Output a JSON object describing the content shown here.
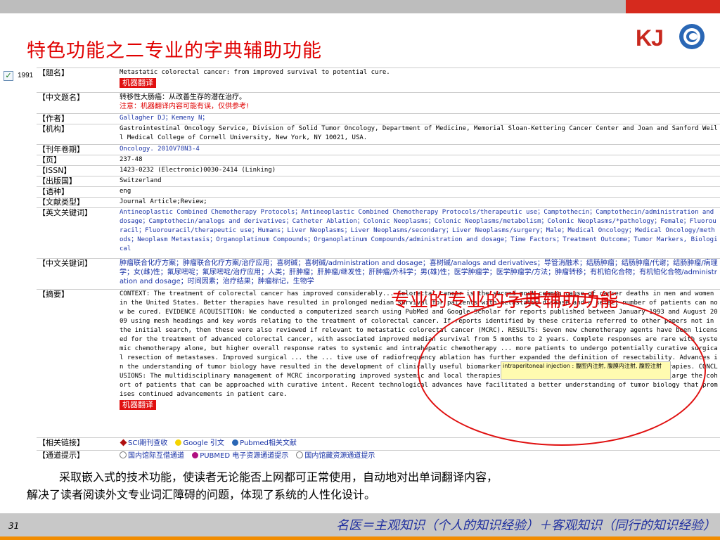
{
  "slide": {
    "title": "特色功能之二专业的字典辅助功能",
    "number": "31",
    "footer": "名医＝主观知识（个人的知识经验）＋客观知识（同行的知识经验）",
    "caption_line1": "采取嵌入式的技术功能，使读者无论能否上网都可正常使用，自动地对出单词翻译内容，",
    "caption_line2": "解决了读者阅读外文专业词汇障碍的问题，体现了系统的人性化设计。",
    "overlay_text": "专业的专业的字典辅助功能",
    "logo": {
      "k": "K",
      "j": "J"
    }
  },
  "record": {
    "year": "1991",
    "mt_button": "机器翻译",
    "tooltip": "intraperitoneal injection : 腹腔内注射, 腹膜内注射, 腹腔注射",
    "fields": {
      "title_label": "【题名】",
      "title_value": "Metastatic colorectal cancer: from improved survival to potential cure.",
      "cn_title_label": "【中文题名】",
      "cn_title_value": "转移性大肠癌：从改善生存的潜在治疗。",
      "cn_title_note": "注意：机器翻译内容可能有误，仅供参考!",
      "author_label": "【作者】",
      "author_value": "Gallagher DJ；Kemeny N；",
      "org_label": "【机构】",
      "org_value": "Gastrointestinal Oncology Service, Division of Solid Tumor Oncology, Department of Medicine, Memorial Sloan-Kettering Cancer Center and Joan and Sanford Weill Medical College of Cornell University, New York, NY 10021, USA.",
      "journal_label": "【刊年卷期】",
      "journal_value": "Oncology. 2010V78N3-4",
      "page_label": "【页】",
      "page_value": "237-48",
      "issn_label": "【ISSN】",
      "issn_value": "1423-0232 (Electronic)0030-2414 (Linking)",
      "country_label": "【出版国】",
      "country_value": "Switzerland",
      "lang_label": "【语种】",
      "lang_value": "eng",
      "type_label": "【文献类型】",
      "type_value": "Journal Article;Review;",
      "en_kw_label": "【英文关键词】",
      "en_kw_value": "Antineoplastic Combined Chemotherapy Protocols；Antineoplastic Combined Chemotherapy Protocols/therapeutic use；Camptothecin；Camptothecin/administration and dosage；Camptothecin/analogs and derivatives；Catheter Ablation；Colonic Neoplasms；Colonic Neoplasms/metabolism；Colonic Neoplasms/*pathology；Female；Fluorouracil；Fluorouracil/therapeutic use；Humans；Liver Neoplasms；Liver Neoplasms/secondary；Liver Neoplasms/surgery；Male；Medical Oncology；Medical Oncology/methods；Neoplasm Metastasis；Organoplatinum Compounds；Organoplatinum Compounds/administration and dosage；Time Factors；Treatment Outcome；Tumor Markers, Biological",
      "cn_kw_label": "【中文关键词】",
      "cn_kw_value": "肿瘤联合化疗方案；肿瘤联合化疗方案/治疗应用；喜树碱；喜树碱/administration and dosage；喜树碱/analogs and derivatives；导管消融术；结肠肿瘤；结肠肿瘤/代谢；结肠肿瘤/病理学；女(雌)性；氟尿嘧啶；氟尿嘧啶/治疗应用；人类；肝肿瘤；肝肿瘤/继发性；肝肿瘤/外科学；男(雄)性；医学肿瘤学；医学肿瘤学/方法；肿瘤转移；有机铂化合物；有机铂化合物/administration and dosage；时间因素；治疗结果；肿瘤标记，生物学",
      "abstract_label": "【摘要】",
      "abstract_value": "CONTEXT: The treatment of colorectal cancer has improved considerably... Colorectal cancer is the second most common cause of cancer deaths in men and women in the United States. Better therapies have resulted in prolonged median survival for patients with metastatic disease and a select number of patients can now be cured. EVIDENCE ACQUISITION: We conducted a computerized search using PubMed and Google Scholar for reports published between January 1993 and August 2009 using mesh headings and key words relating to the treatment of colorectal cancer. If reports identified by these criteria referred to other papers not in the initial search, then these were also reviewed if relevant to metastatic colorectal cancer (MCRC). RESULTS: Seven new chemotherapy agents have been licensed for the treatment of advanced colorectal cancer, with associated improved median survival from 5 months to 2 years. Complete responses are rare with systemic chemotherapy alone, but higher overall response rates to systemic and intrahepatic chemotherapy ... more patients to undergo potentially curative surgical resection of metastases. Improved surgical ... the ... tive use of radiofrequency ablation has further expanded the definition of resectability. Advances in the understanding of tumor biology have resulted in the development of clinically useful biomarkers and the emergence of active biological therapies. CONCLUSIONS: The multidisciplinary management of MCRC incorporating improved systemic and local therapies continues to improve median survival and enlarge the cohort of patients that can be approached with curative intent. Recent technological advances have facilitated a better understanding of tumor biology that promises continued advancements in patient care.",
      "links_label": "【相关链接】",
      "link_sci": "SCI期刊查收",
      "link_google": "Google 引文",
      "link_pubmed": "Pubmed相关文献",
      "channel_label": "【通道提示】",
      "channel_1": "国内馆际互借通道",
      "channel_2": "PUBMED 电子资源通道提示",
      "channel_3": "国内馆藏资源通道提示"
    }
  }
}
